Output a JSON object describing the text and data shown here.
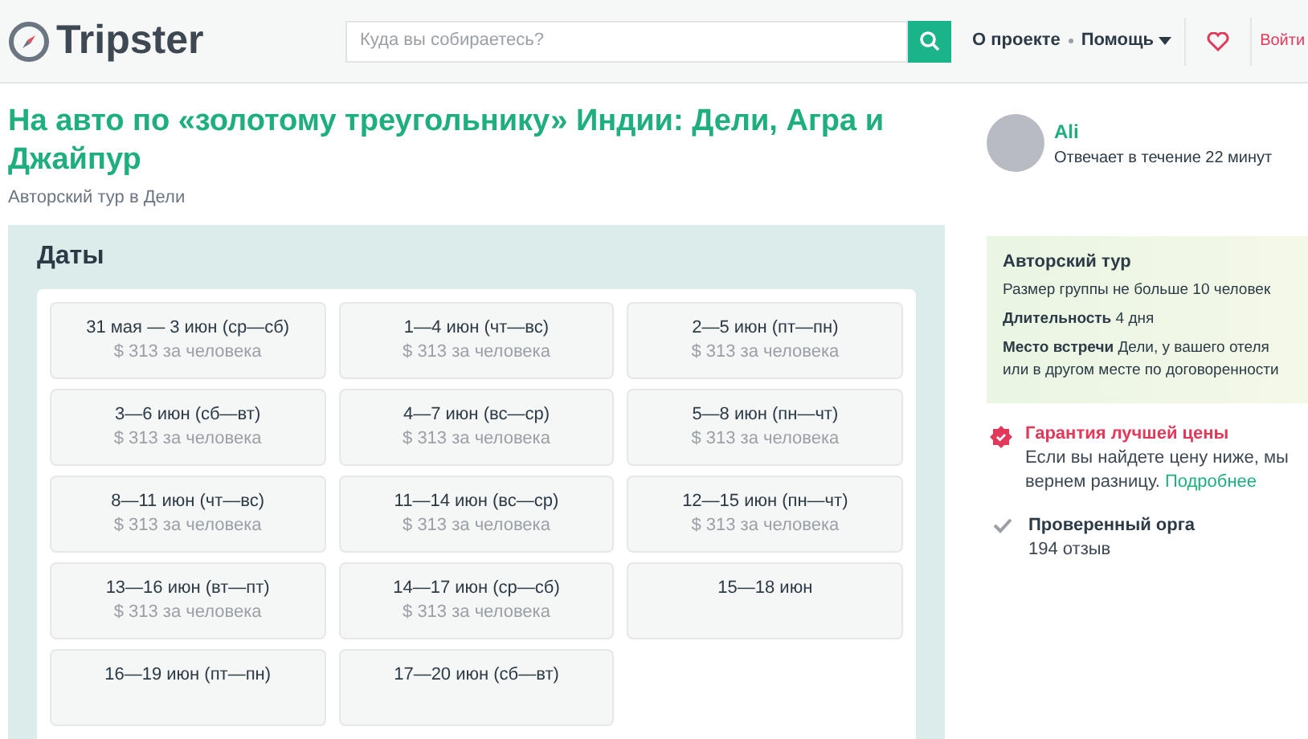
{
  "header": {
    "logo": "Tripster",
    "search": {
      "placeholder": "Куда вы собираетесь?"
    },
    "nav": [
      "О проекте",
      "Помощь"
    ],
    "login": "Войти"
  },
  "tour": {
    "title": "На авто по «золотому треугольнику» Индии: Дели, Агра и Джайпур",
    "subtitle": "Авторский тур в Дели"
  },
  "dates": {
    "heading": "Даты",
    "items": [
      {
        "date": "31 мая — 3 июн (ср—сб)",
        "price": "$ 313 за человека"
      },
      {
        "date": "1—4 июн (чт—вс)",
        "price": "$ 313 за человека"
      },
      {
        "date": "2—5 июн (пт—пн)",
        "price": "$ 313 за человека"
      },
      {
        "date": "3—6 июн (сб—вт)",
        "price": "$ 313 за человека"
      },
      {
        "date": "4—7 июн (вс—ср)",
        "price": "$ 313 за человека"
      },
      {
        "date": "5—8 июн (пн—чт)",
        "price": "$ 313 за человека"
      },
      {
        "date": "8—11 июн (чт—вс)",
        "price": "$ 313 за человека"
      },
      {
        "date": "11—14 июн (вс—ср)",
        "price": "$ 313 за человека"
      },
      {
        "date": "12—15 июн (пн—чт)",
        "price": "$ 313 за человека"
      },
      {
        "date": "13—16 июн (вт—пт)",
        "price": "$ 313 за человека"
      },
      {
        "date": "14—17 июн (ср—сб)",
        "price": "$ 313 за человека"
      },
      {
        "date": "15—18 июн"
      },
      {
        "date": "16—19 июн (пт—пн)"
      },
      {
        "date": "17—20 июн (сб—вт)"
      }
    ]
  },
  "guide": {
    "name": "Ali",
    "response": "Отвечает в течение 22 минут"
  },
  "info": {
    "title": "Авторский тур",
    "lines": [
      "Размер группы не больше 10 человек",
      "**Длительность** 4 дня",
      "**Место встречи** Дели, у вашего отеля или в другом месте по договоренности"
    ]
  },
  "features": [
    {
      "kind": "guarantee",
      "title": "Гарантия лучшей цены",
      "text": "Если вы найдете цену ниже, мы вернем разницу.",
      "link": "Подробнее"
    },
    {
      "kind": "verified",
      "title": "Проверенный орга",
      "text": "194 отзыв"
    }
  ]
}
